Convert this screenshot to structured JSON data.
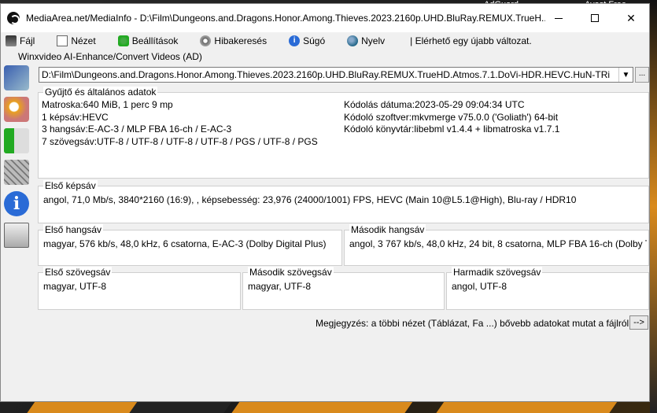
{
  "desktop": {
    "labels": [
      "AdGuard",
      "Avast Free"
    ]
  },
  "window": {
    "title": "MediaArea.net/MediaInfo - D:\\Film\\Dungeons.and.Dragons.Honor.Among.Thieves.2023.2160p.UHD.BluRay.REMUX.TrueH..."
  },
  "menu": {
    "items": [
      "Fájl",
      "Nézet",
      "Beállítások",
      "Hibakeresés",
      "Súgó",
      "Nyelv"
    ],
    "update_note": "| Elérhető egy újabb változat."
  },
  "plugin_line": "Winxvideo AI-Enhance/Convert Videos (AD)",
  "file_combo": {
    "value": "D:\\Film\\Dungeons.and.Dragons.Honor.Among.Thieves.2023.2160p.UHD.BluRay.REMUX.TrueHD.Atmos.7.1.DoVi-HDR.HEVC.HuN-TRi",
    "browse_label": "..."
  },
  "general": {
    "title": "Gyűjtő és általános adatok",
    "left": [
      "Matroska:640 MiB, 1 perc 9 mp",
      "1 képsáv:HEVC",
      "3 hangsáv:E-AC-3 / MLP FBA 16-ch / E-AC-3",
      "7 szövegsáv:UTF-8 / UTF-8 / UTF-8 / UTF-8 / PGS / UTF-8 / PGS"
    ],
    "right": [
      "Kódolás dátuma:2023-05-29 09:04:34 UTC",
      "Kódoló szoftver:mkvmerge v75.0.0 ('Goliath') 64-bit",
      "Kódoló könyvtár:libebml v1.4.4 + libmatroska v1.7.1"
    ]
  },
  "video": {
    "title": "Első képsáv",
    "text": "angol, 71,0 Mb/s, 3840*2160 (16:9), , képsebesség: 23,976 (24000/1001) FPS, HEVC (Main 10@L5.1@High), Blu-ray / HDR10"
  },
  "audio": [
    {
      "title": "Első hangsáv",
      "text": "magyar, 576 kb/s, 48,0 kHz, 6 csatorna, E-AC-3 (Dolby Digital Plus)"
    },
    {
      "title": "Második hangsáv",
      "text": "angol, 3 767 kb/s, 48,0 kHz, 24 bit, 8 csatorna, MLP FBA 16-ch (Dolby T"
    }
  ],
  "text_tracks": [
    {
      "title": "Első szövegsáv",
      "text": "magyar, UTF-8"
    },
    {
      "title": "Második szövegsáv",
      "text": "magyar, UTF-8"
    },
    {
      "title": "Harmadik szövegsáv",
      "text": "angol, UTF-8"
    }
  ],
  "note": {
    "text": "Megjegyzés: a többi nézet (Táblázat, Fa ...) bővebb adatokat mutat a fájlról",
    "button_label": "-->"
  }
}
